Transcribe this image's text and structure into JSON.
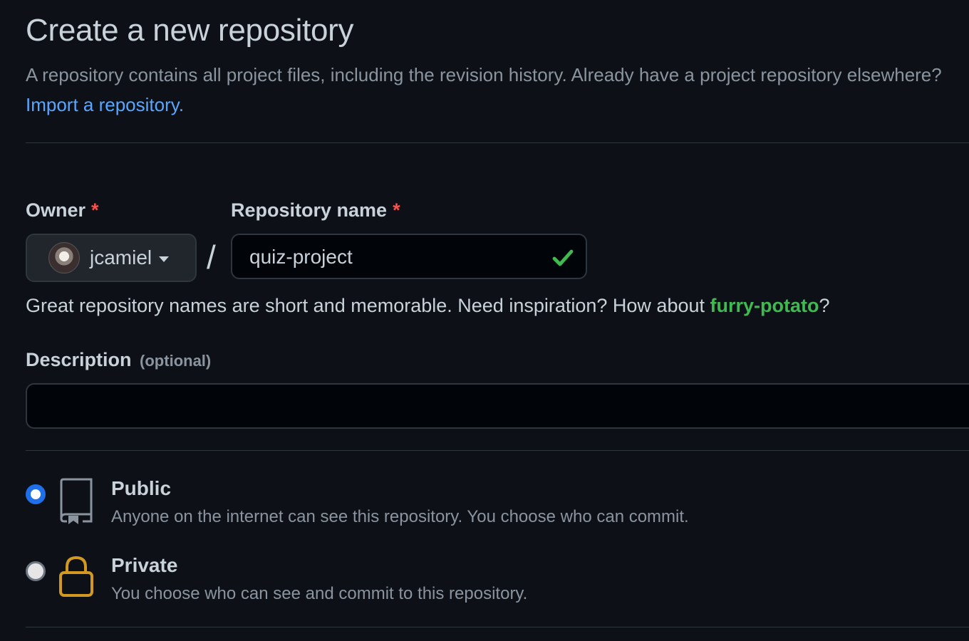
{
  "header": {
    "title": "Create a new repository",
    "subtitle": "A repository contains all project files, including the revision history. Already have a project repository elsewhere?",
    "import_link": "Import a repository."
  },
  "owner": {
    "label": "Owner",
    "required_mark": "*",
    "value": "jcamiel",
    "avatar_icon": "user-avatar"
  },
  "repo_name": {
    "label": "Repository name",
    "required_mark": "*",
    "value": "quiz-project",
    "status_icon": "check-icon",
    "separator": "/"
  },
  "hint": {
    "prefix": "Great repository names are short and memorable. Need inspiration? How about",
    "suggestion": "furry-potato",
    "suffix": "?"
  },
  "description": {
    "label": "Description",
    "optional": "(optional)",
    "value": ""
  },
  "visibility": {
    "selected": "public",
    "options": [
      {
        "id": "public",
        "title": "Public",
        "desc": "Anyone on the internet can see this repository. You choose who can commit.",
        "icon": "repo-icon"
      },
      {
        "id": "private",
        "title": "Private",
        "desc": "You choose who can see and commit to this repository.",
        "icon": "lock-icon"
      }
    ]
  },
  "colors": {
    "background": "#0d1117",
    "link": "#58a6ff",
    "success": "#3fb950",
    "required": "#f85149",
    "radio_selected": "#1f6feb",
    "lock": "#d29922"
  }
}
